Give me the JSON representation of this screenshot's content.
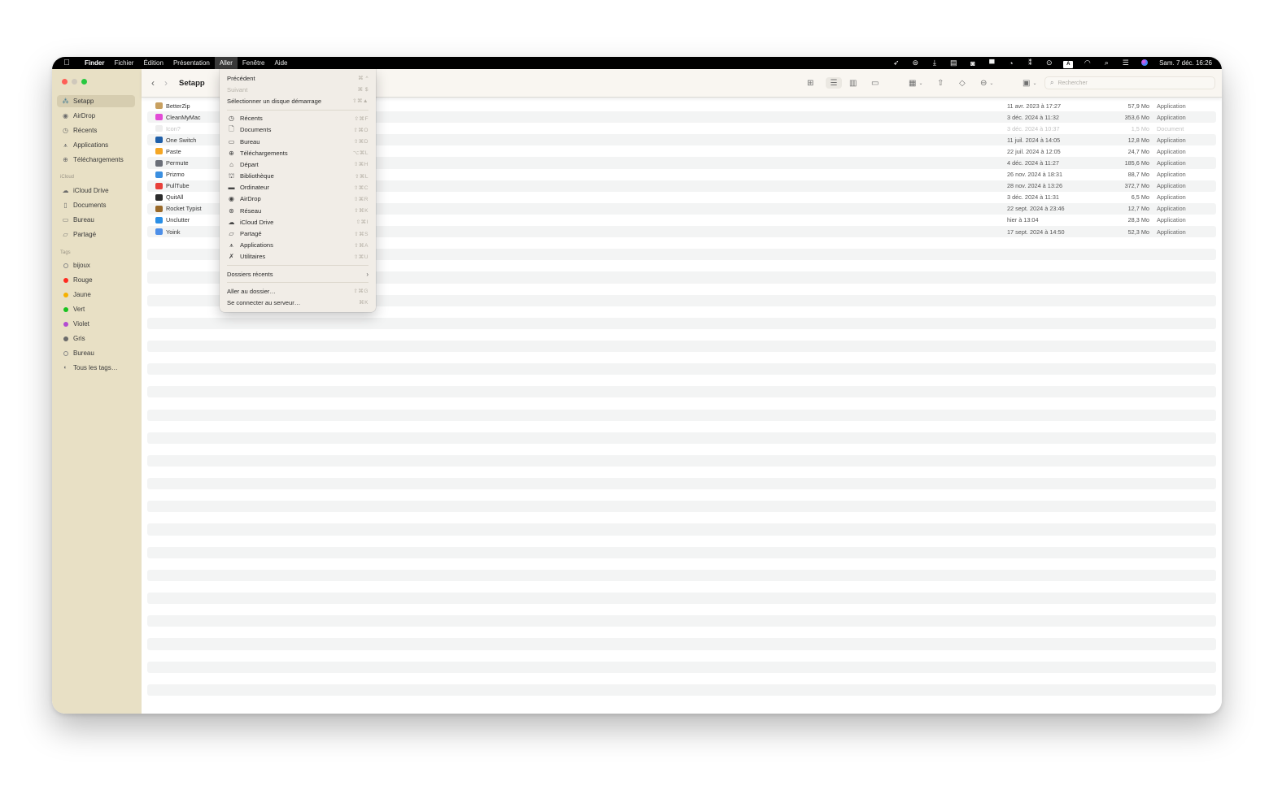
{
  "menubar": {
    "apple": "",
    "app": "Finder",
    "items": [
      "Fichier",
      "Édition",
      "Présentation",
      "Aller",
      "Fenêtre",
      "Aide"
    ],
    "active": "Aller",
    "status_icons": [
      "rocket-icon",
      "setapp-square-icon",
      "download-icon",
      "archive-box-icon",
      "pastebot-icon",
      "display-icon",
      "refresh-circle-icon",
      "setapp-badge-icon",
      "play-circle-icon",
      "input-source-icon",
      "wifi-icon",
      "spotlight-icon",
      "control-center-icon",
      "siri-icon"
    ],
    "input_source": "A",
    "clock": "Sam. 7 déc. 16:26"
  },
  "sidebar": {
    "favorites": [
      {
        "label": "Setapp",
        "icon": "setapp-icon",
        "selected": true
      },
      {
        "label": "AirDrop",
        "icon": "airdrop-icon"
      },
      {
        "label": "Récents",
        "icon": "clock-icon"
      },
      {
        "label": "Applications",
        "icon": "applications-icon"
      },
      {
        "label": "Téléchargements",
        "icon": "download-circle-icon"
      }
    ],
    "icloud_title": "iCloud",
    "icloud": [
      {
        "label": "iCloud Drive",
        "icon": "cloud-icon"
      },
      {
        "label": "Documents",
        "icon": "document-icon"
      },
      {
        "label": "Bureau",
        "icon": "desktop-icon"
      },
      {
        "label": "Partagé",
        "icon": "shared-folder-icon"
      }
    ],
    "tags_title": "Tags",
    "tags": [
      {
        "label": "bijoux",
        "color": null
      },
      {
        "label": "Rouge",
        "color": "#ff2a1f"
      },
      {
        "label": "Jaune",
        "color": "#f5b100"
      },
      {
        "label": "Vert",
        "color": "#18c21f"
      },
      {
        "label": "Violet",
        "color": "#b34bd1"
      },
      {
        "label": "Gris",
        "color": "#6b6b6b"
      },
      {
        "label": "Bureau",
        "color": null
      },
      {
        "label": "Tous les tags…",
        "color": "all"
      }
    ]
  },
  "toolbar": {
    "back": "‹",
    "forward": "›",
    "title": "Setapp",
    "search_placeholder": "Rechercher"
  },
  "files": [
    {
      "name": "BetterZip",
      "date": "11 avr. 2023 à 17:27",
      "size": "57,9 Mo",
      "kind": "Application",
      "icon_color": "#c8a060"
    },
    {
      "name": "CleanMyMac",
      "date": "3 déc. 2024 à 11:32",
      "size": "353,6 Mo",
      "kind": "Application",
      "icon_color": "#e24bd6"
    },
    {
      "name": "Icon?",
      "date": "3 déc. 2024 à 10:37",
      "size": "1,5 Mo",
      "kind": "Document",
      "icon_color": "#eeeeee",
      "dim": true
    },
    {
      "name": "One Switch",
      "date": "11 juil. 2024 à 14:05",
      "size": "12,8 Mo",
      "kind": "Application",
      "icon_color": "#1f5fa8"
    },
    {
      "name": "Paste",
      "date": "22 juil. 2024 à 12:05",
      "size": "24,7 Mo",
      "kind": "Application",
      "icon_color": "#f5a623"
    },
    {
      "name": "Permute",
      "date": "4 déc. 2024 à 11:27",
      "size": "185,6 Mo",
      "kind": "Application",
      "icon_color": "#6b6f78"
    },
    {
      "name": "Prizmo",
      "date": "26 nov. 2024 à 18:31",
      "size": "88,7 Mo",
      "kind": "Application",
      "icon_color": "#3b8fe0"
    },
    {
      "name": "PullTube",
      "date": "28 nov. 2024 à 13:26",
      "size": "372,7 Mo",
      "kind": "Application",
      "icon_color": "#e8403a"
    },
    {
      "name": "QuitAll",
      "date": "3 déc. 2024 à 11:31",
      "size": "6,5 Mo",
      "kind": "Application",
      "icon_color": "#2b2b2b"
    },
    {
      "name": "Rocket Typist",
      "date": "22 sept. 2024 à 23:46",
      "size": "12,7 Mo",
      "kind": "Application",
      "icon_color": "#9a6a2a"
    },
    {
      "name": "Unclutter",
      "date": "hier à 13:04",
      "size": "28,3 Mo",
      "kind": "Application",
      "icon_color": "#2a8fe6"
    },
    {
      "name": "Yoink",
      "date": "17 sept. 2024 à 14:50",
      "size": "52,3 Mo",
      "kind": "Application",
      "icon_color": "#4d8fe8"
    }
  ],
  "dropdown": {
    "groups": [
      [
        {
          "label": "Précédent",
          "shortcut": "⌘ ^"
        },
        {
          "label": "Suivant",
          "shortcut": "⌘ $",
          "disabled": true
        },
        {
          "label": "Sélectionner un disque démarrage",
          "shortcut": "⇧⌘▲"
        }
      ],
      [
        {
          "label": "Récents",
          "shortcut": "⇧⌘F",
          "icon": "clock-icon",
          "glyph": "◷"
        },
        {
          "label": "Documents",
          "shortcut": "⇧⌘O",
          "icon": "document-icon",
          "glyph": "🗋"
        },
        {
          "label": "Bureau",
          "shortcut": "⇧⌘D",
          "icon": "desktop-icon",
          "glyph": "▭"
        },
        {
          "label": "Téléchargements",
          "shortcut": "⌥⌘L",
          "icon": "download-circle-icon",
          "glyph": "⊕"
        },
        {
          "label": "Départ",
          "shortcut": "⇧⌘H",
          "icon": "home-icon",
          "glyph": "⌂"
        },
        {
          "label": "Bibliothèque",
          "shortcut": "⇧⌘L",
          "icon": "library-icon",
          "glyph": "⛫"
        },
        {
          "label": "Ordinateur",
          "shortcut": "⇧⌘C",
          "icon": "computer-icon",
          "glyph": "▬"
        },
        {
          "label": "AirDrop",
          "shortcut": "⇧⌘R",
          "icon": "airdrop-icon",
          "glyph": "◉"
        },
        {
          "label": "Réseau",
          "shortcut": "⇧⌘K",
          "icon": "network-icon",
          "glyph": "⊛"
        },
        {
          "label": "iCloud Drive",
          "shortcut": "⇧⌘I",
          "icon": "cloud-icon",
          "glyph": "☁"
        },
        {
          "label": "Partagé",
          "shortcut": "⇧⌘S",
          "icon": "shared-folder-icon",
          "glyph": "▱"
        },
        {
          "label": "Applications",
          "shortcut": "⇧⌘A",
          "icon": "applications-icon",
          "glyph": "⩚"
        },
        {
          "label": "Utilitaires",
          "shortcut": "⇧⌘U",
          "icon": "utilities-icon",
          "glyph": "✗"
        }
      ],
      [
        {
          "label": "Dossiers récents",
          "submenu": "›"
        }
      ],
      [
        {
          "label": "Aller au dossier…",
          "shortcut": "⇧⌘G"
        },
        {
          "label": "Se connecter au serveur…",
          "shortcut": "⌘K"
        }
      ]
    ]
  }
}
